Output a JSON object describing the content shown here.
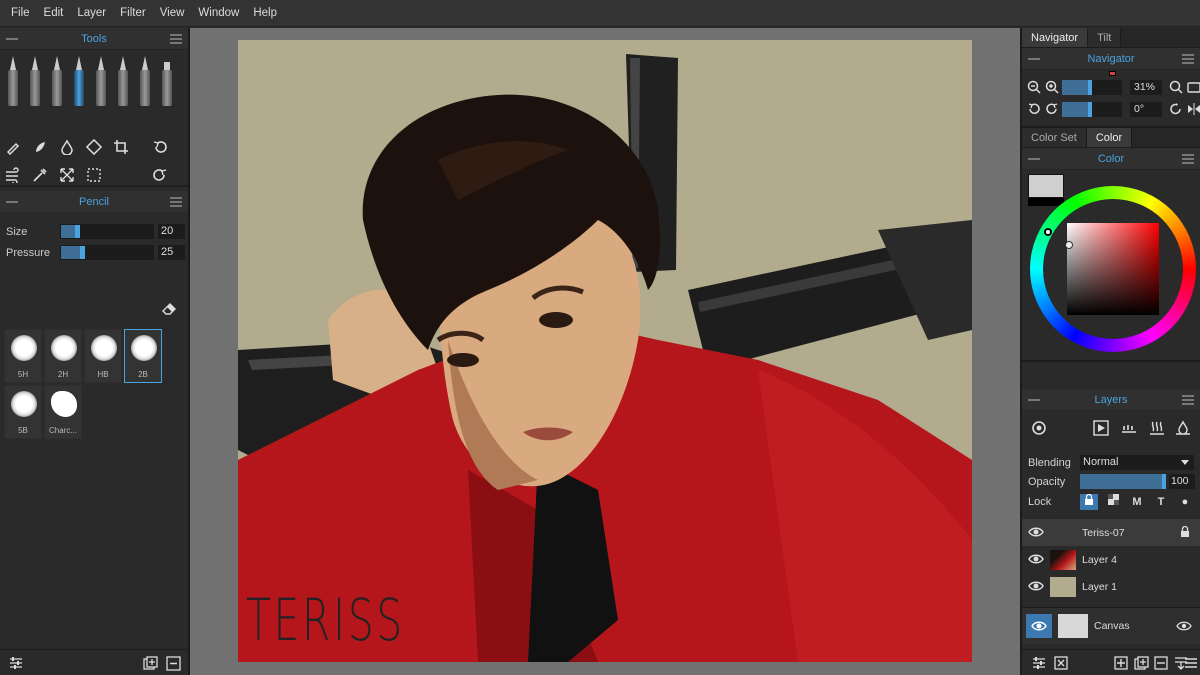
{
  "menu": [
    "File",
    "Edit",
    "Layer",
    "Filter",
    "View",
    "Window",
    "Help"
  ],
  "tools_panel": {
    "title": "Tools"
  },
  "pencil_panel": {
    "title": "Pencil",
    "size_label": "Size",
    "size_value": "20",
    "size_level": 0.2,
    "pressure_label": "Pressure",
    "pressure_value": "25",
    "pressure_level": 0.25,
    "presets": [
      "5H",
      "2H",
      "HB",
      "2B",
      "5B",
      "Charc..."
    ],
    "selected_preset": "2B"
  },
  "artwork": {
    "signature": "TERISS",
    "background": "#b2ab8e"
  },
  "right": {
    "nav_tabs": [
      "Navigator",
      "Tilt"
    ],
    "navigator_title": "Navigator",
    "zoom": "31%",
    "zoom_level": 0.5,
    "rotation": "0°",
    "rotation_level": 0.5,
    "color_tabs": [
      "Color Set",
      "Color"
    ],
    "color_title": "Color",
    "current_color": "#cfcfcf",
    "secondary_color": "#000000",
    "layers_title": "Layers",
    "blending_label": "Blending",
    "blending_value": "Normal",
    "opacity_label": "Opacity",
    "opacity_value": "100",
    "opacity_level": 1.0,
    "lock_label": "Lock",
    "layers": [
      {
        "name": "Teriss-07",
        "visible": true,
        "selected": true,
        "locked": true
      },
      {
        "name": "Layer 4",
        "visible": true
      },
      {
        "name": "Layer 1",
        "visible": true
      }
    ],
    "canvas_label": "Canvas"
  },
  "colors": {
    "accent": "#4aa3df",
    "panel": "#2a2a2a",
    "menubar": "#333333",
    "workspace": "#717171"
  }
}
